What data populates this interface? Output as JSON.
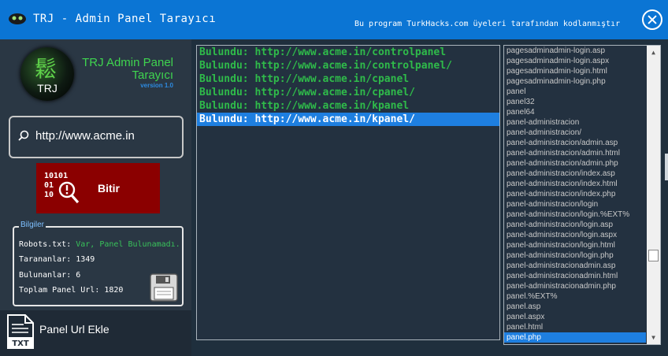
{
  "window": {
    "title": "TRJ - Admin Panel Tarayıcı",
    "subtitle": "Bu program TurkHacks.com üyeleri tarafından kodlanmıştır"
  },
  "logo": {
    "mark": "TRJ",
    "title_line1": "TRJ Admin Panel",
    "title_line2": "Tarayıcı",
    "version": "version 1.0"
  },
  "search": {
    "value": "http://www.acme.in"
  },
  "bitir_button": {
    "label": "Bitir"
  },
  "info": {
    "legend": "Bilgiler",
    "robots_label": "Robots.txt:",
    "robots_value": "Var, Panel Bulunamadı.",
    "scanned_label": "Taranan​lar:",
    "scanned_value": "1349",
    "found_label": "Bulunanlar:",
    "found_value": "6",
    "total_label": "Toplam Panel Url:",
    "total_value": "1820"
  },
  "add_url": {
    "icon_text": "TXT",
    "label": "Panel Url Ekle"
  },
  "results": [
    {
      "text": "Bulundu: http://www.acme.in/controlpanel",
      "selected": false
    },
    {
      "text": "Bulundu: http://www.acme.in/controlpanel/",
      "selected": false
    },
    {
      "text": "Bulundu: http://www.acme.in/cpanel",
      "selected": false
    },
    {
      "text": "Bulundu: http://www.acme.in/cpanel/",
      "selected": false
    },
    {
      "text": "Bulundu: http://www.acme.in/kpanel",
      "selected": false
    },
    {
      "text": "Bulundu: http://www.acme.in/kpanel/",
      "selected": true
    }
  ],
  "wordlist": [
    {
      "text": "pagesadminadmin-login.asp",
      "selected": false
    },
    {
      "text": "pagesadminadmin-login.aspx",
      "selected": false
    },
    {
      "text": "pagesadminadmin-login.html",
      "selected": false
    },
    {
      "text": "pagesadminadmin-login.php",
      "selected": false
    },
    {
      "text": "panel",
      "selected": false
    },
    {
      "text": "panel32",
      "selected": false
    },
    {
      "text": "panel64",
      "selected": false
    },
    {
      "text": "panel-administracion",
      "selected": false
    },
    {
      "text": "panel-administracion/",
      "selected": false
    },
    {
      "text": "panel-administracion/admin.asp",
      "selected": false
    },
    {
      "text": "panel-administracion/admin.html",
      "selected": false
    },
    {
      "text": "panel-administracion/admin.php",
      "selected": false
    },
    {
      "text": "panel-administracion/index.asp",
      "selected": false
    },
    {
      "text": "panel-administracion/index.html",
      "selected": false
    },
    {
      "text": "panel-administracion/index.php",
      "selected": false
    },
    {
      "text": "panel-administracion/login",
      "selected": false
    },
    {
      "text": "panel-administracion/login.%EXT%",
      "selected": false
    },
    {
      "text": "panel-administracion/login.asp",
      "selected": false
    },
    {
      "text": "panel-administracion/login.aspx",
      "selected": false
    },
    {
      "text": "panel-administracion/login.html",
      "selected": false
    },
    {
      "text": "panel-administracion/login.php",
      "selected": false
    },
    {
      "text": "panel-administracionadmin.asp",
      "selected": false
    },
    {
      "text": "panel-administracionadmin.html",
      "selected": false
    },
    {
      "text": "panel-administracionadmin.php",
      "selected": false
    },
    {
      "text": "panel.%EXT%",
      "selected": false
    },
    {
      "text": "panel.asp",
      "selected": false
    },
    {
      "text": "panel.aspx",
      "selected": false
    },
    {
      "text": "panel.html",
      "selected": false
    },
    {
      "text": "panel.php",
      "selected": true
    }
  ],
  "icons": {
    "app": "hacker-logo-icon",
    "close": "close-icon",
    "search": "search-icon",
    "scan": "binary-magnifier-icon",
    "save": "floppy-disk-icon",
    "txt": "txt-file-icon"
  },
  "colors": {
    "titlebar": "#0b75d4",
    "found_text": "#2fbb4a",
    "selection": "#1e7fe0",
    "stop_button": "#8b0000"
  }
}
